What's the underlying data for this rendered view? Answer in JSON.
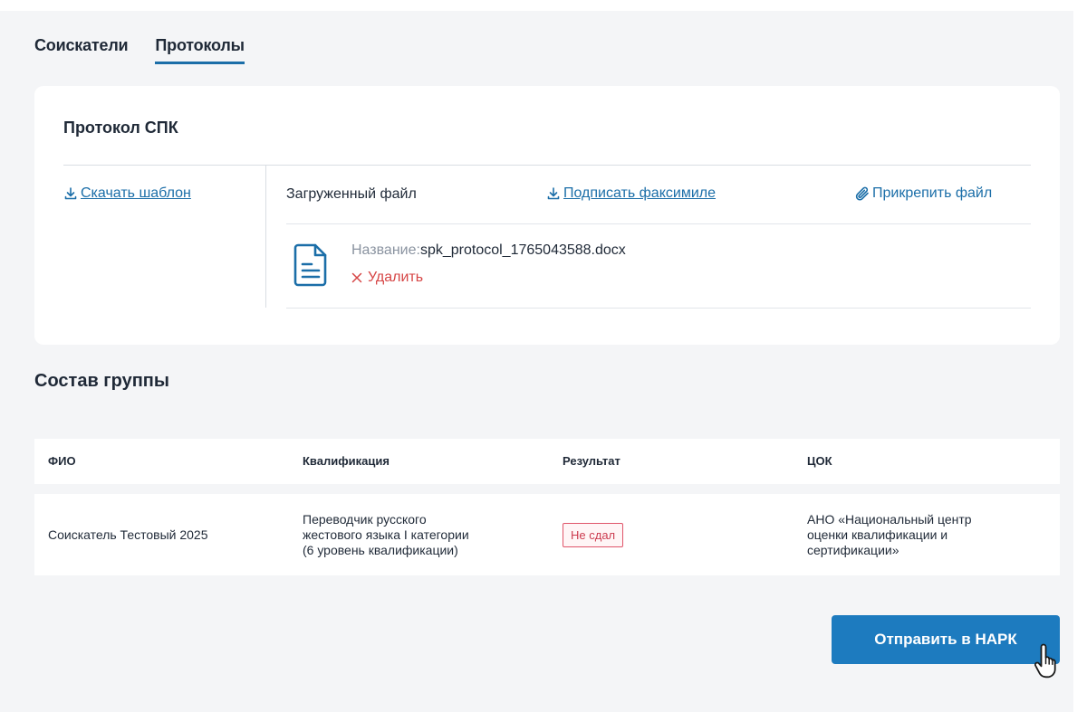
{
  "tabs": [
    {
      "label": "Соискатели",
      "active": false
    },
    {
      "label": "Протоколы",
      "active": true
    }
  ],
  "protocol": {
    "title": "Протокол СПК",
    "download_template": "Скачать шаблон",
    "uploaded_file_label": "Загруженный файл",
    "sign_facsimile": "Подписать факсимиле",
    "attach_file": "Прикрепить файл",
    "file": {
      "name_label": "Название:",
      "name": "spk_protocol_1765043588.docx",
      "delete_label": "Удалить"
    }
  },
  "group": {
    "title": "Состав группы",
    "columns": [
      "ФИО",
      "Квалификация",
      "Результат",
      "ЦОК"
    ],
    "rows": [
      {
        "fio": "Соискатель Тестовый 2025",
        "qualification": [
          "Переводчик русского",
          "жестового языка I категории",
          "(6 уровень квалификации)"
        ],
        "result": "Не сдал",
        "center": [
          "АНО «Национальный центр",
          "оценки квалификации и",
          "сертификации»"
        ]
      }
    ]
  },
  "send_button": "Отправить в НАРК",
  "colors": {
    "accent": "#1b6ea8",
    "button": "#1d7bbf",
    "danger": "#d64545",
    "background": "#f4f5f7"
  },
  "icons": {
    "download": "download-icon",
    "attach": "paperclip-icon",
    "file": "document-icon",
    "delete": "close-icon",
    "cursor": "hand-pointer-icon"
  }
}
